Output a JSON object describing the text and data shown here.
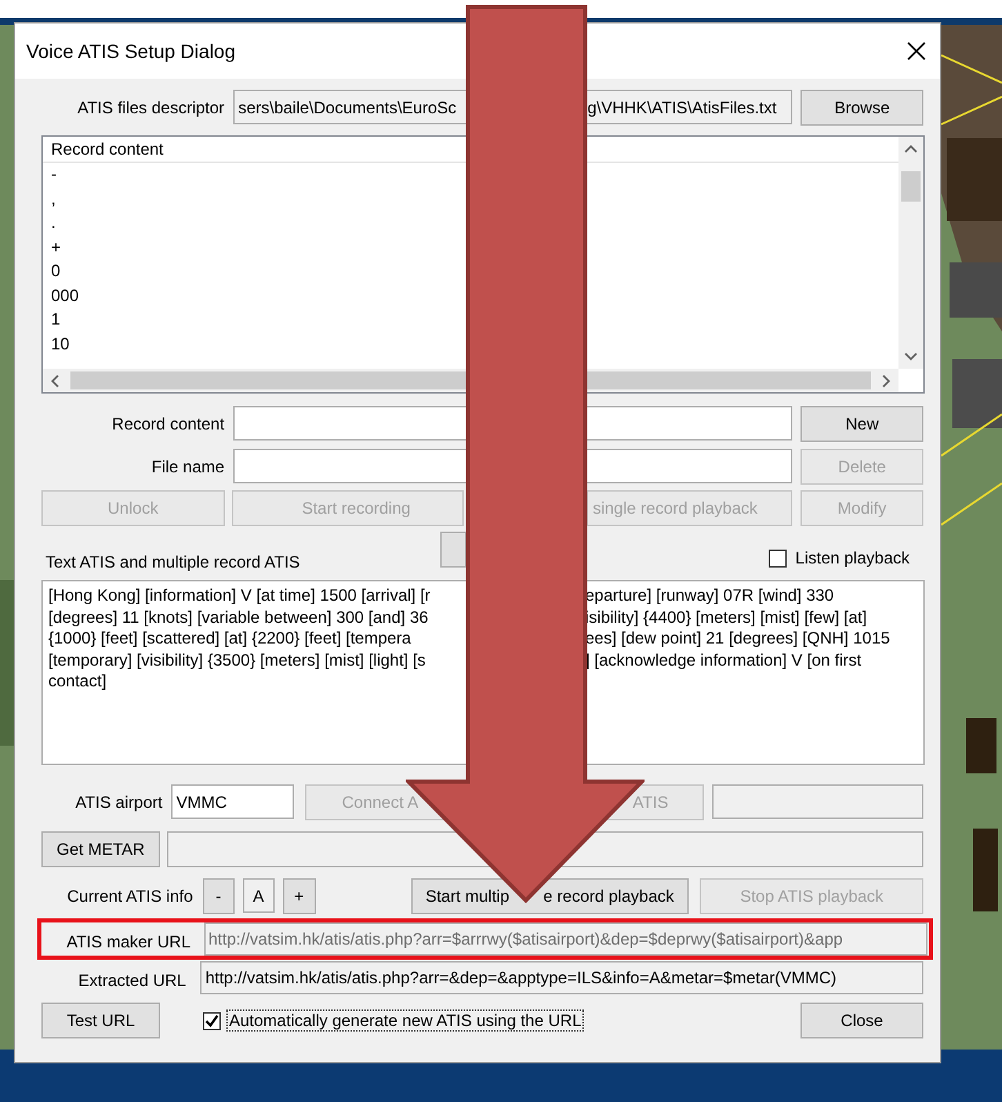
{
  "window": {
    "title": "Voice ATIS Setup Dialog"
  },
  "files_descriptor": {
    "label": "ATIS files descriptor",
    "value_parts": [
      "sers\\baile\\Documents\\EuroSc",
      "g\\VHHK\\ATIS\\AtisFiles.txt"
    ],
    "button": {
      "label": "Browse",
      "disabled": false
    }
  },
  "record_list": {
    "header": "Record content",
    "items": [
      "-",
      ",",
      ".",
      "+",
      "0",
      "000",
      "1",
      "10"
    ]
  },
  "record_content": {
    "label": "Record content",
    "button": {
      "label": "New",
      "disabled": false
    }
  },
  "file_name": {
    "label": "File name",
    "button": {
      "label": "Delete",
      "disabled": true
    }
  },
  "record_buttons": [
    {
      "label": "Unlock",
      "disabled": true
    },
    {
      "label": "Start recording",
      "disabled": true
    },
    {
      "label": "single record playback",
      "disabled": true
    },
    {
      "label": "Modify",
      "disabled": true
    }
  ],
  "text_atis": {
    "label": "Text ATIS and multiple record ATIS",
    "listen_playback": {
      "label": "Listen playback",
      "checked": false
    },
    "lines": [
      [
        "[Hong Kong] [information] V [at time] 1500 [arrival] [r",
        "eparture] [runway] 07R [wind] 330"
      ],
      [
        "[degrees] 11 [knots] [variable between] 300 [and] 36",
        "isibility] {4400} [meters] [mist] [few] [at]"
      ],
      [
        "{1000} [feet] [scattered] [at] {2200} [feet] [tempera",
        "ees] [dew point] 21 [degrees] [QNH] 1015"
      ],
      [
        "[temporary] [visibility] {3500} [meters] [mist] [light] [s",
        "] [acknowledge information] V [on first"
      ],
      [
        "contact]"
      ]
    ]
  },
  "atis_airport": {
    "label": "ATIS airport",
    "value": "VMMC",
    "connect_button": {
      "parts": [
        "Connect A",
        "ATIS"
      ],
      "disabled": true
    }
  },
  "get_metar": {
    "label": "Get METAR",
    "disabled": false
  },
  "current_info": {
    "label": "Current ATIS info",
    "minus": "-",
    "letter": "A",
    "plus": "+",
    "start_button": {
      "parts": [
        "Start multip",
        "e record playback"
      ],
      "disabled": false
    },
    "stop_button": {
      "label": "Stop ATIS playback",
      "disabled": true
    }
  },
  "maker_url": {
    "label": "ATIS maker URL",
    "value": "http://vatsim.hk/atis/atis.php?arr=$arrrwy($atisairport)&dep=$deprwy($atisairport)&app",
    "disabled": true,
    "highlighted": true
  },
  "extracted_url": {
    "label": "Extracted URL",
    "value": "http://vatsim.hk/atis/atis.php?arr=&dep=&apptype=ILS&info=A&metar=$metar(VMMC)"
  },
  "test_url": {
    "label": "Test URL"
  },
  "auto_generate": {
    "label": "Automatically generate new ATIS using the URL",
    "checked": true
  },
  "close_button": {
    "label": "Close"
  }
}
